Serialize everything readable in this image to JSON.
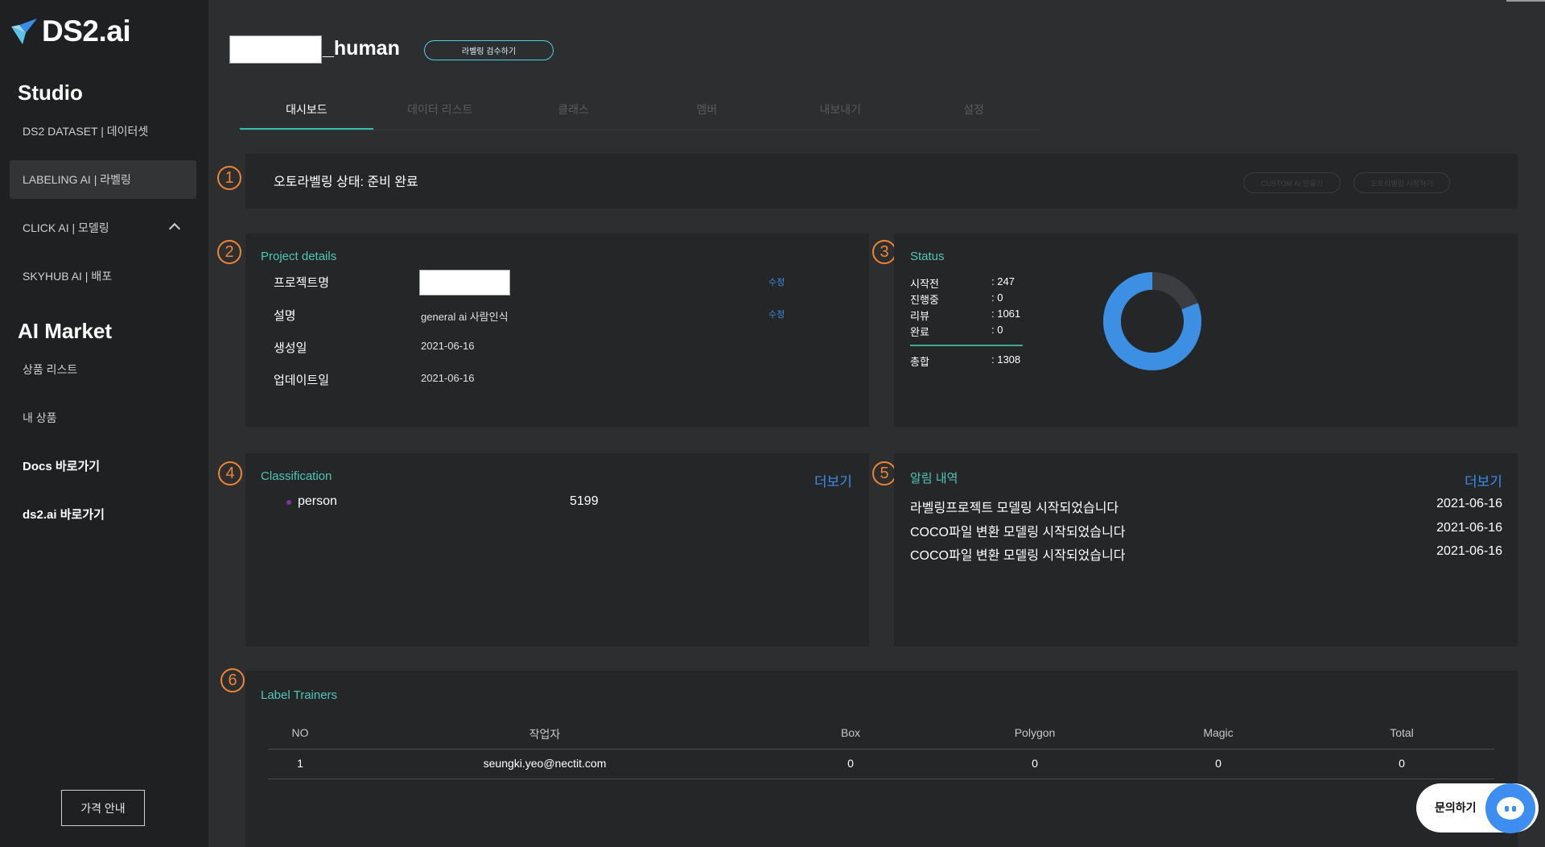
{
  "brand": {
    "logo_text": "DS2.ai"
  },
  "sidebar": {
    "studio_title": "Studio",
    "studio_items": [
      {
        "label": "DS2 DATASET | 데이터셋"
      },
      {
        "label": "LABELING AI | 라벨링"
      },
      {
        "label": "CLICK AI | 모델링"
      },
      {
        "label": "SKYHUB AI | 배포"
      }
    ],
    "market_title": "AI Market",
    "market_items": [
      {
        "label": "상품 리스트"
      },
      {
        "label": "내 상품"
      }
    ],
    "links": [
      {
        "label": "Docs 바로가기"
      },
      {
        "label": "ds2.ai 바로가기"
      }
    ],
    "price_button": "가격 안내"
  },
  "header": {
    "project_suffix": "_human",
    "review_button": "라벨링 검수하기"
  },
  "tabs": [
    {
      "label": "대시보드"
    },
    {
      "label": "데이터 리스트"
    },
    {
      "label": "클래스"
    },
    {
      "label": "멤버"
    },
    {
      "label": "내보내기"
    },
    {
      "label": "설정"
    }
  ],
  "badges": [
    "1",
    "2",
    "3",
    "4",
    "5",
    "6"
  ],
  "autolabel": {
    "status_text": "오토라벨링 상태: 준비 완료",
    "custom_button": "CUSTOM AI 만들기",
    "start_button": "오토라벨링 시작하기"
  },
  "project_details": {
    "title": "Project details",
    "rows": [
      {
        "label": "프로젝트명",
        "value": "",
        "edit": "수정"
      },
      {
        "label": "설명",
        "value": "general ai 사람인식",
        "edit": "수정"
      },
      {
        "label": "생성일",
        "value": "2021-06-16"
      },
      {
        "label": "업데이트일",
        "value": "2021-06-16"
      }
    ]
  },
  "status": {
    "title": "Status",
    "rows": [
      {
        "label": "시작전",
        "value": ": 247"
      },
      {
        "label": "진행중",
        "value": ": 0"
      },
      {
        "label": "리뷰",
        "value": ": 1061"
      },
      {
        "label": "완료",
        "value": ": 0"
      }
    ],
    "total_label": "총합",
    "total_value": ": 1308",
    "donut": {
      "before": 247,
      "in_progress": 0,
      "review": 1061,
      "done": 0,
      "color_review": "#3d8fe3",
      "color_before": "#3c3d40"
    }
  },
  "classification": {
    "title": "Classification",
    "more": "더보기",
    "items": [
      {
        "name": "person",
        "count": "5199",
        "color": "#7a3b8a"
      }
    ]
  },
  "alarms": {
    "title": "알림 내역",
    "more": "더보기",
    "items": [
      {
        "text": "라벨링프로젝트 모델링 시작되었습니다",
        "date": "2021-06-16"
      },
      {
        "text": "COCO파일 변환 모델링 시작되었습니다",
        "date": "2021-06-16"
      },
      {
        "text": "COCO파일 변환 모델링 시작되었습니다",
        "date": "2021-06-16"
      }
    ]
  },
  "trainers": {
    "title": "Label Trainers",
    "columns": [
      "NO",
      "작업자",
      "Box",
      "Polygon",
      "Magic",
      "Total"
    ],
    "rows": [
      [
        "1",
        "seungki.yeo@nectit.com",
        "0",
        "0",
        "0",
        "0"
      ]
    ]
  },
  "chat": {
    "label": "문의하기"
  }
}
